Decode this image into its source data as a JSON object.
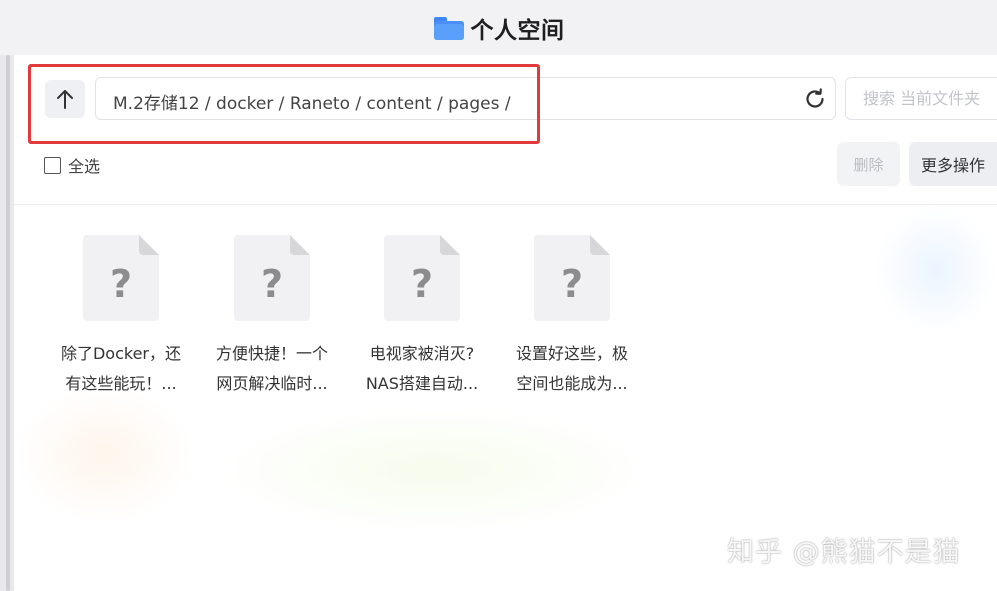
{
  "window": {
    "title": "个人空间",
    "title_icon": "folder-icon"
  },
  "toolbar": {
    "up_icon": "arrow-up-icon",
    "path": "M.2存储12 / docker / Raneto / content / pages /",
    "refresh_icon": "refresh-icon",
    "search_placeholder": "搜索 当前文件夹",
    "highlight_color": "#e03a3a"
  },
  "actions": {
    "select_all_label": "全选",
    "delete_label": "删除",
    "more_label": "更多操作"
  },
  "files": [
    {
      "line1": "除了Docker，还",
      "line2": "有这些能玩！...",
      "icon": "unknown-file-icon"
    },
    {
      "line1": "方便快捷！一个",
      "line2": "网页解决临时...",
      "icon": "unknown-file-icon"
    },
    {
      "line1": "电视家被消灭?",
      "line2": "NAS搭建自动...",
      "icon": "unknown-file-icon"
    },
    {
      "line1": "设置好这些，极",
      "line2": "空间也能成为...",
      "icon": "unknown-file-icon"
    }
  ],
  "watermark": "知乎 @熊猫不是猫"
}
